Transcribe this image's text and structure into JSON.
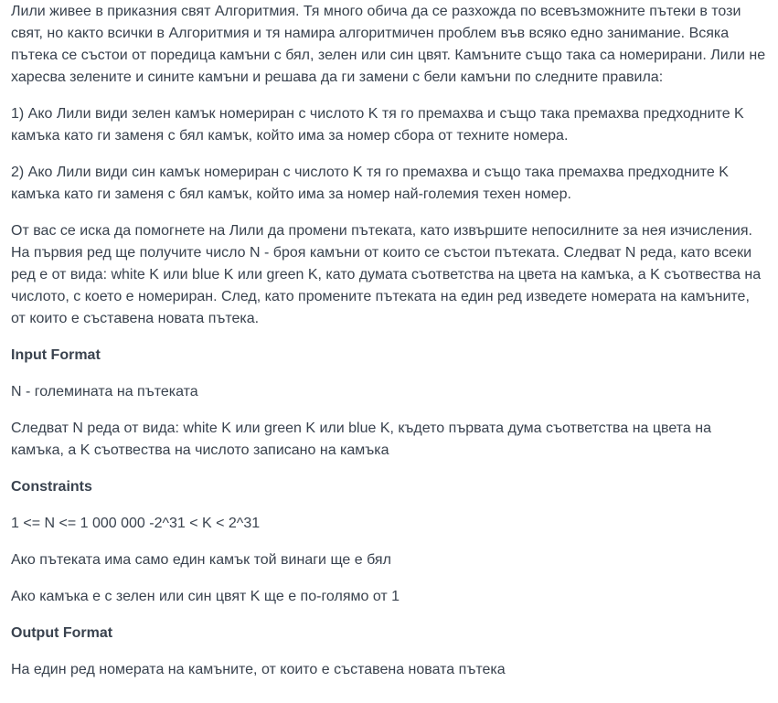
{
  "statement": {
    "intro": "Лили живее в приказния свят Алгоритмия. Тя много обича да се разхожда по всевъзможните пътеки в този свят, но както всички в Алгоритмия и тя намира алгоритмичен проблем във всяко едно занимание. Всяка пътека се състои от поредица камъни с бял, зелен или син цвят. Камъните също така са номерирани. Лили не харесва зелените и сините камъни и решава да ги замени с бели камъни по следните правила:",
    "rule_green": "1) Ако Лили види зелен камък номериран с числото K тя го премахва и също така премахва предходните K камъка като ги заменя с бял камък, който има за номер сбора от техните номера.",
    "rule_blue": "2) Ако Лили види син камък номериран с числото K тя го премахва и също така премахва предходните K камъка като ги заменя с бял камък, който има за номер най-големия техен номер.",
    "task": "От вас се иска да помогнете на Лили да промени пътеката, като извършите непосилните за нея изчисления. На първия ред ще получите число N - броя камъни от които се състои пътеката. Следват N реда, като всеки ред е от вида: white K или blue K или green K, като думата съответства на цвета на камъка, а K съотвества на числото, с което е номериран. След, като промените пътеката на един ред изведете номерата на камъните, от които е съставена новата пътека."
  },
  "input_format": {
    "heading": "Input Format",
    "line1": "N - големината на пътеката",
    "line2": "Следват N реда от вида: white K или green K или blue K, където първата дума съответства на цвета на камъка, а K съотвества на числото записано на камъка"
  },
  "constraints": {
    "heading": "Constraints",
    "line1": "1 <= N <= 1 000 000 -2^31 < K < 2^31",
    "line2": "Ако пътеката има само един камък той винаги ще е бял",
    "line3": "Ако камъка е с зелен или син цвят K ще е по-голямо от 1"
  },
  "output_format": {
    "heading": "Output Format",
    "line1": "На един ред номерата на камъните, от които е съставена новата пътека"
  }
}
